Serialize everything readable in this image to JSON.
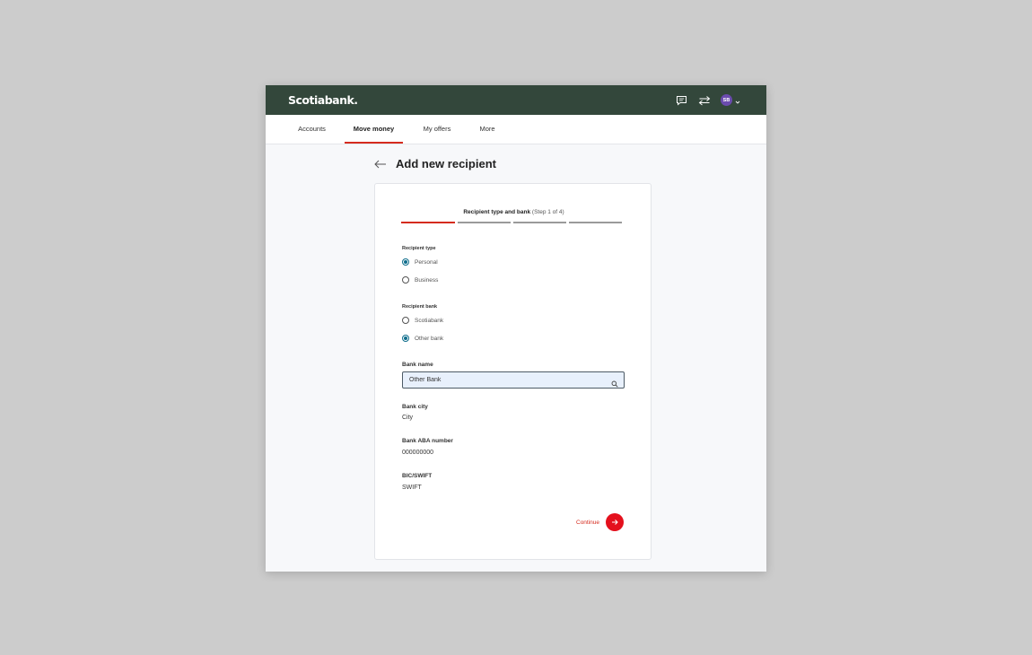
{
  "header": {
    "logo": "Scotiabank.",
    "avatar_initials": "SB"
  },
  "nav": {
    "items": [
      {
        "label": "Accounts"
      },
      {
        "label": "Move money"
      },
      {
        "label": "My offers"
      },
      {
        "label": "More"
      }
    ],
    "active": "Move money"
  },
  "page": {
    "title": "Add new recipient"
  },
  "stepper": {
    "title": "Recipient type and bank",
    "subtitle": "(Step 1 of 4)",
    "current_step": 1,
    "total_steps": 4
  },
  "recipient_type": {
    "label": "Recipient type",
    "options": [
      "Personal",
      "Business"
    ],
    "selected": "Personal"
  },
  "recipient_bank": {
    "label": "Recipient bank",
    "options": [
      "Scotiabank",
      "Other bank"
    ],
    "selected": "Other bank"
  },
  "bank_name": {
    "label": "Bank name",
    "value": "Other Bank"
  },
  "bank_city": {
    "label": "Bank city",
    "value": "City"
  },
  "bank_aba": {
    "label": "Bank ABA number",
    "value": "000000000"
  },
  "bic_swift": {
    "label": "BIC/SWIFT",
    "value": "SWIFT"
  },
  "actions": {
    "continue_label": "Continue"
  },
  "colors": {
    "header_bg": "#33473b",
    "accent_red": "#d52b1e",
    "radio_teal": "#0f6e8c",
    "avatar_purple": "#6b4bae"
  },
  "icons": [
    "chat-icon",
    "transfer-icon",
    "chevron-down-icon",
    "back-arrow-icon",
    "search-icon",
    "arrow-right-icon"
  ]
}
